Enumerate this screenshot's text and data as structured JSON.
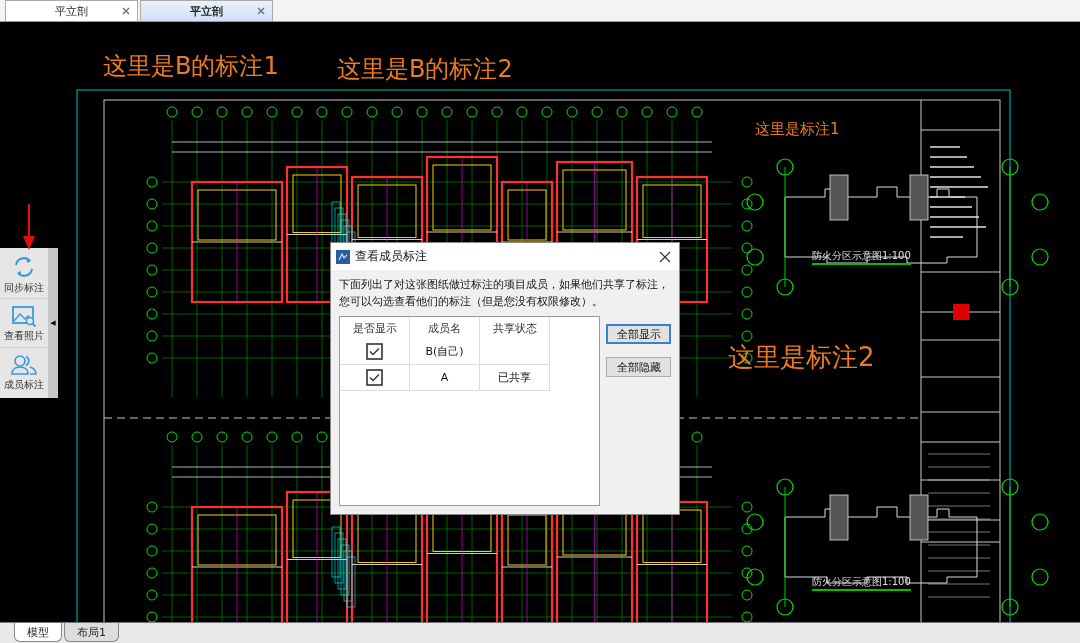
{
  "tabs": [
    {
      "label": "平立剖",
      "selected": false
    },
    {
      "label": "平立剖",
      "selected": true
    }
  ],
  "canvas": {
    "annotations": [
      {
        "text": "这里是B的标注1"
      },
      {
        "text": "这里是B的标注2"
      },
      {
        "text": "这里是标注1"
      },
      {
        "text": "这里是标注2"
      }
    ],
    "plan_captions": [
      "防火分区示意图1:100",
      "防火分区示意图1:100"
    ]
  },
  "side_toolbar": {
    "items": [
      {
        "label": "同步标注",
        "kind": "sync"
      },
      {
        "label": "查看照片",
        "kind": "photo"
      },
      {
        "label": "成员标注",
        "kind": "members"
      }
    ],
    "collapse_glyph": "◀"
  },
  "dialog": {
    "title": "查看成员标注",
    "message": "下面列出了对这张图纸做过标注的项目成员，如果他们共享了标注，您可以勾选查看他们的标注（但是您没有权限修改）。",
    "table": {
      "columns": [
        "是否显示",
        "成员名",
        "共享状态"
      ],
      "rows": [
        {
          "show": true,
          "member": "B(自己)"
        },
        {
          "show": true,
          "member": "A",
          "share_status": "已共享"
        }
      ]
    },
    "buttons": [
      {
        "label": "全部显示",
        "default": true
      },
      {
        "label": "全部隐藏",
        "default": false
      }
    ]
  },
  "bottom_tabs": [
    {
      "label": "模型",
      "selected": true
    },
    {
      "label": "布局1",
      "selected": false
    }
  ]
}
